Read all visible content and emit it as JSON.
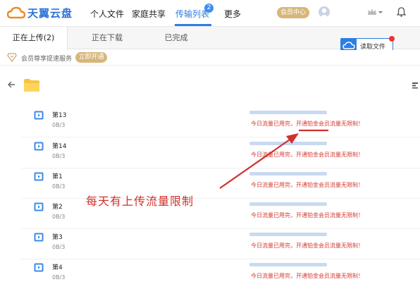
{
  "app": {
    "name": "天翼云盘"
  },
  "nav": {
    "items": [
      {
        "label": "个人文件"
      },
      {
        "label": "家庭共享"
      },
      {
        "label": "传输列表",
        "badge": "2"
      },
      {
        "label": "更多"
      }
    ],
    "vip_label": "会员中心"
  },
  "tabs": [
    {
      "label": "正在上传(2)"
    },
    {
      "label": "正在下载"
    },
    {
      "label": "已完成"
    }
  ],
  "read_file_label": "读取文件",
  "promo": {
    "text": "会员尊享提速服务",
    "button": "立即开通"
  },
  "files": [
    {
      "name": "第13",
      "size": "0B/3",
      "limit_text": "今日流量已用完，开通铂金会员流量无限制！"
    },
    {
      "name": "第14",
      "size": "0B/3",
      "limit_text": "今日流量已用完，开通铂金会员流量无限制！"
    },
    {
      "name": "第1",
      "size": "0B/3",
      "limit_text": "今日流量已用完，开通铂金会员流量无限制！"
    },
    {
      "name": "第2",
      "size": "0B/3",
      "limit_text": "今日流量已用完，开通铂金会员流量无限制！"
    },
    {
      "name": "第3",
      "size": "0B/3",
      "limit_text": "今日流量已用完，开通铂金会员流量无限制！"
    },
    {
      "name": "第4",
      "size": "0B/3",
      "limit_text": "今日流量已用完，开通铂金会员流量无限制！"
    }
  ],
  "annotation": "每天有上传流量限制",
  "colors": {
    "accent": "#2b7ee4",
    "warning": "#d43a2f",
    "gold": "#d8b67a"
  }
}
